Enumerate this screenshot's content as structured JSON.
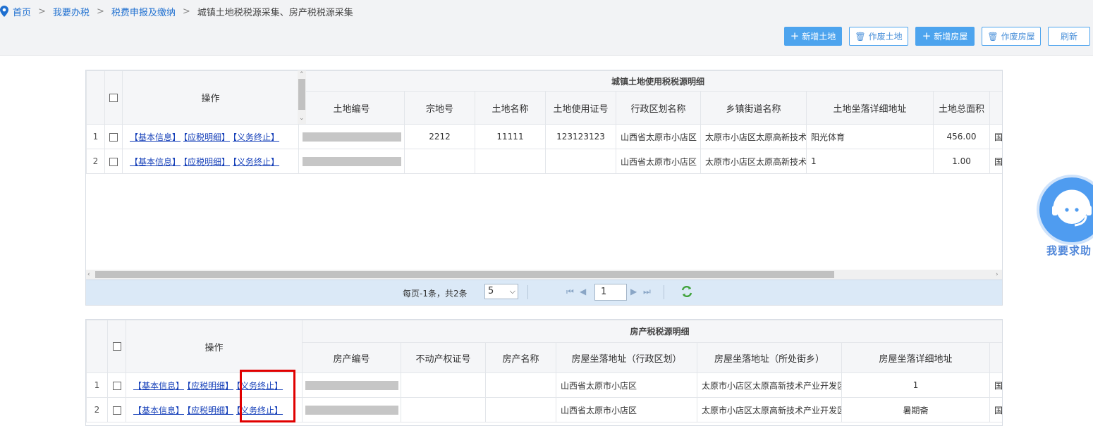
{
  "breadcrumb": {
    "items": [
      "首页",
      "我要办税",
      "税费申报及缴纳"
    ],
    "separator": ">",
    "current": "城镇土地税税源采集、房产税税源采集"
  },
  "toolbar": {
    "add_land": "新增土地",
    "void_land": "作废土地",
    "add_house": "新增房屋",
    "void_house": "作废房屋",
    "refresh": "刷新"
  },
  "land_grid": {
    "group_title": "城镇土地使用税税源明细",
    "op_header": "操作",
    "columns": [
      "土地编号",
      "宗地号",
      "土地名称",
      "土地使用证号",
      "行政区划名称",
      "乡镇街道名称",
      "土地坐落详细地址",
      "土地总面积"
    ],
    "ops": [
      "【基本信息】",
      "【应税明细】",
      "【义务终止】"
    ],
    "rows": [
      {
        "num": "1",
        "zongdi": "2212",
        "name": "11111",
        "cert": "123123123",
        "region": "山西省太原市小店区",
        "street": "太原市小店区太原高新技术",
        "address": "阳光体育",
        "area": "456.00",
        "extra": "国"
      },
      {
        "num": "2",
        "zongdi": "",
        "name": "",
        "cert": "",
        "region": "山西省太原市小店区",
        "street": "太原市小店区太原高新技术",
        "address": "1",
        "area": "1.00",
        "extra": "国"
      }
    ]
  },
  "pager": {
    "summary": "每页-1条，共2条",
    "page_size": "5",
    "current_page": "1"
  },
  "house_grid": {
    "group_title": "房产税税源明细",
    "op_header": "操作",
    "columns": [
      "房产编号",
      "不动产权证号",
      "房产名称",
      "房屋坐落地址（行政区划）",
      "房屋坐落地址（所处街乡）",
      "房屋坐落详细地址"
    ],
    "ops": [
      "【基本信息】",
      "【应税明细】",
      "【义务终止】"
    ],
    "rows": [
      {
        "num": "1",
        "cert": "",
        "name": "",
        "region": "山西省太原市小店区",
        "street": "太原市小店区太原高新技术产业开发区",
        "address": "1",
        "extra": "国"
      },
      {
        "num": "2",
        "cert": "",
        "name": "",
        "region": "山西省太原市小店区",
        "street": "太原市小店区太原高新技术产业开发区",
        "address": "暑期斋",
        "extra": "国"
      }
    ]
  },
  "help": {
    "label": "我要求助"
  },
  "colors": {
    "primary": "#4da4ee",
    "link": "#1640b9",
    "highlight": "#e00000",
    "pager_bg": "#dbe9f7"
  }
}
